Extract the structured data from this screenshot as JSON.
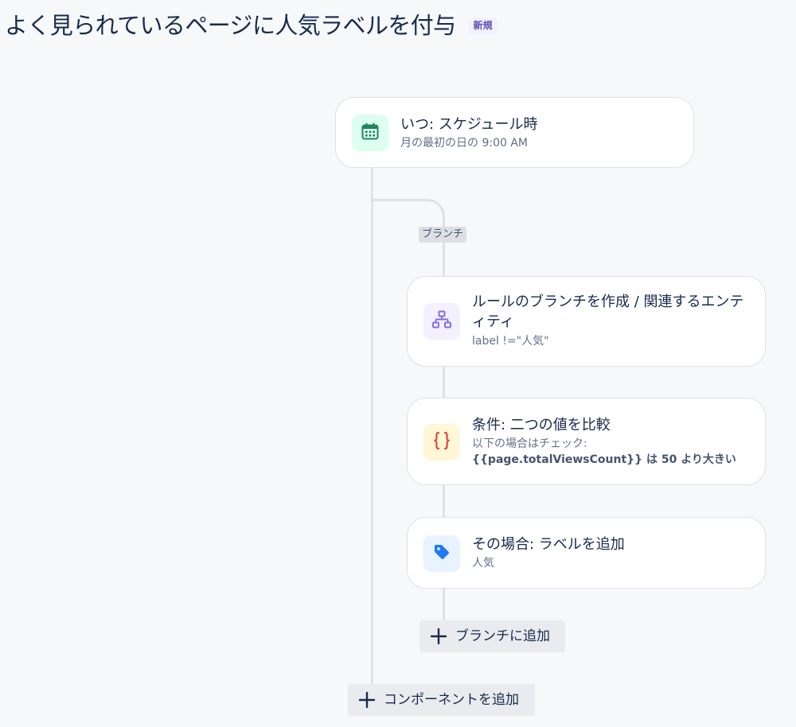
{
  "header": {
    "title": "よく見られているページに人気ラベルを付与",
    "badge": "新規"
  },
  "flow": {
    "trigger": {
      "icon": "calendar-icon",
      "title": "いつ: スケジュール時",
      "subtitle": "月の最初の日の 9:00 AM"
    },
    "branch_tag": "ブランチ",
    "branch": {
      "icon": "branch-hierarchy-icon",
      "title": "ルールのブランチを作成 / 関連するエンティティ",
      "subtitle": "label !=\"人気\""
    },
    "condition": {
      "icon": "curly-braces-icon",
      "title": "条件: 二つの値を比較",
      "subtitle": "以下の場合はチェック:",
      "detail": "{{page.totalViewsCount}} は 50 より大きい"
    },
    "action": {
      "icon": "tag-icon",
      "title": "その場合: ラベルを追加",
      "subtitle": "人気"
    },
    "add_to_branch_label": "ブランチに追加",
    "add_component_label": "コンポーネントを追加"
  },
  "colors": {
    "trigger_icon": "#1f845a",
    "trigger_tile": "#dcfff1",
    "branch_icon": "#8270db",
    "branch_tile": "#f3f0ff",
    "condition_icon": "#e2483d",
    "condition_tile": "#fff7d6",
    "action_icon": "#1d7afc",
    "action_tile": "#e9f2ff",
    "badge_text": "#5e4db2",
    "badge_bg": "#f3f0ff"
  }
}
